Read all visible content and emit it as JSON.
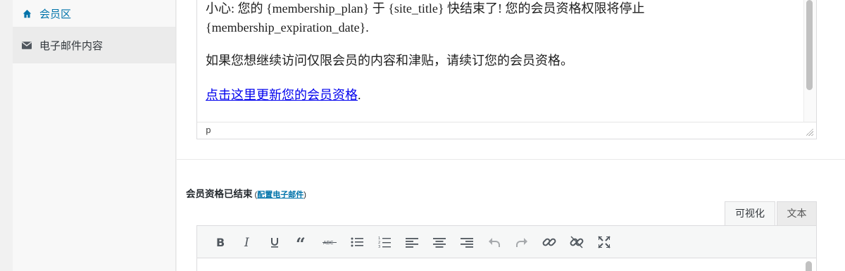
{
  "sidebar": {
    "items": [
      {
        "label": "会员区",
        "icon": "home-icon"
      },
      {
        "label": "电子邮件内容",
        "icon": "envelope-icon"
      }
    ]
  },
  "editor_top": {
    "paragraphs": [
      "小心: 您的 {membership_plan} 于 {site_title} 快结束了! 您的会员资格权限将停止 {membership_expiration_date}.",
      "如果您想继续访问仅限会员的内容和津贴，请续订您的会员资格。"
    ],
    "link_text": "点击这里更新您的会员资格",
    "link_suffix": ".",
    "status_path": "p"
  },
  "section": {
    "title": "会员资格已结束",
    "paren_open": " (",
    "config_link": "配置电子邮件",
    "paren_close": ")"
  },
  "tabs": {
    "visual": "可视化",
    "text": "文本"
  },
  "toolbar": {
    "buttons": [
      "bold-icon",
      "italic-icon",
      "underline-icon",
      "blockquote-icon",
      "strikethrough-icon",
      "bullet-list-icon",
      "numbered-list-icon",
      "align-left-icon",
      "align-center-icon",
      "align-right-icon",
      "undo-icon",
      "redo-icon",
      "link-icon",
      "unlink-icon",
      "fullscreen-icon"
    ]
  },
  "colors": {
    "accent": "#0073aa",
    "link": "#0000ee"
  }
}
